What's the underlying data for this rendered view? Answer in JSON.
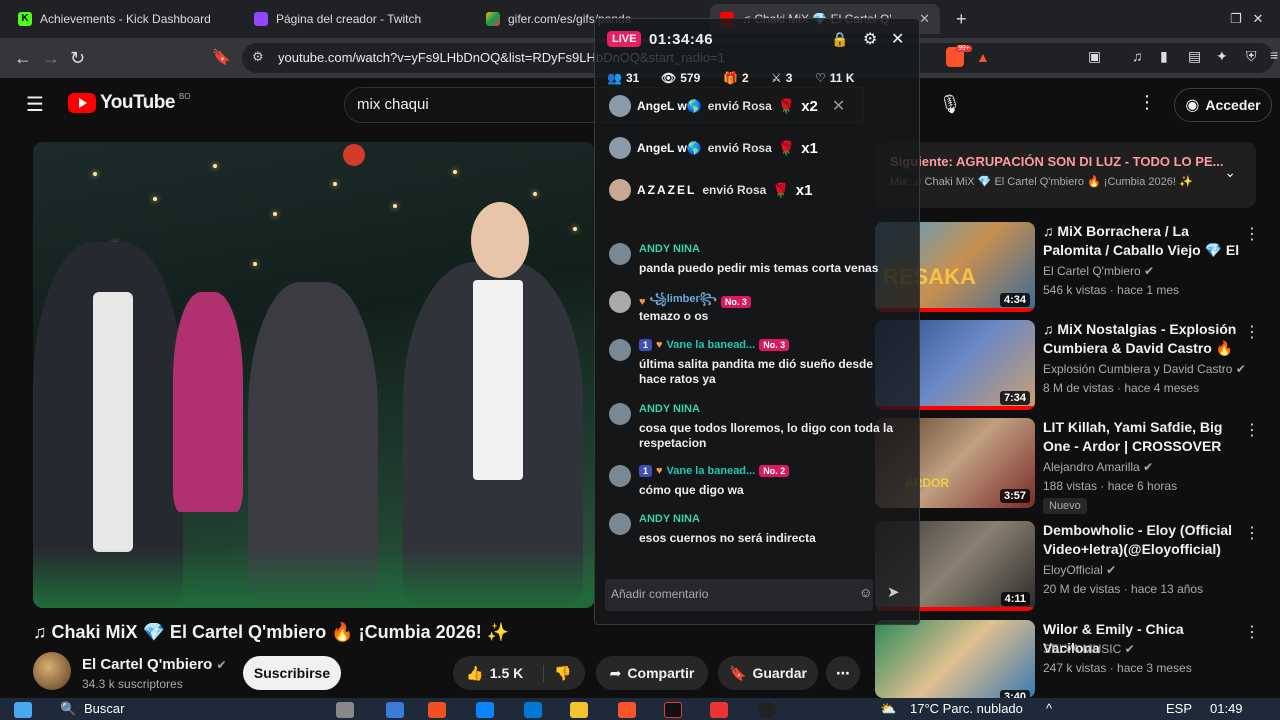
{
  "browser": {
    "tabs": [
      {
        "label": "Achievements - Kick Dashboard",
        "color": "#53fc18",
        "letter": "K"
      },
      {
        "label": "Página del creador - Twitch",
        "color": "#9146ff",
        "letter": ""
      },
      {
        "label": "gifer.com/es/gifs/panda",
        "color": "#f4b400",
        "letter": ""
      },
      {
        "label": "♫ Chaki MiX 💎 El Cartel Q'",
        "color": "#ff0000",
        "letter": ""
      }
    ],
    "new_tab": "+",
    "url": "youtube.com/watch?v=yFs9LHbDnOQ&list=RDyFs9LHbDnOQ&start_radio=1",
    "brave_count": "99+"
  },
  "youtube": {
    "logo_text": "YouTube",
    "logo_region": "BO",
    "search_value": "mix chaqui",
    "signin_label": "Acceder"
  },
  "video": {
    "title": "♫ Chaki MiX 💎 El Cartel Q'mbiero 🔥 ¡Cumbia 2026! ✨",
    "channel": "El Cartel Q'mbiero",
    "subscribers": "34.3 k suscriptores",
    "subscribe_label": "Suscribirse",
    "likes": "1.5 K",
    "share_label": "Compartir",
    "save_label": "Guardar"
  },
  "next": {
    "label": "Siguiente:",
    "title": "AGRUPACIÓN SON DI LUZ - TODO LO PE...",
    "playlist": "Mix: ♫ Chaki MiX 💎 El Cartel Q'mbiero 🔥 ¡Cumbia 2026! ✨"
  },
  "recommendations": [
    {
      "title": "♫ MiX Borrachera / La Palomita / Caballo Viejo 💎 El Cartel ...",
      "channel": "El Cartel Q'mbiero",
      "meta": "546 k vistas · hace 1 mes",
      "duration": "4:34",
      "badge": "",
      "watched": 1.0
    },
    {
      "title": "♫ MiX Nostalgias - Explosión Cumbiera & David Castro 🔥 ¡#...",
      "channel": "Explosión Cumbiera y David Castro",
      "meta": "8 M de vistas · hace 4 meses",
      "duration": "7:34",
      "badge": "",
      "watched": 1.0
    },
    {
      "title": "LIT Killah, Yami Safdie, Big One - Ardor | CROSSOVER #13 ...",
      "channel": "Alejandro Amarilla",
      "meta": "188 vistas · hace 6 horas",
      "duration": "3:57",
      "badge": "Nuevo",
      "watched": 0
    },
    {
      "title": "Dembowholic - Eloy (Official Video+letra)(@Eloyofficial)",
      "channel": "EloyOfficial",
      "meta": "20 M de vistas · hace 13 años",
      "duration": "4:11",
      "badge": "",
      "watched": 1.0
    },
    {
      "title": "Wilor & Emily - Chica Vacilona",
      "channel": "SELVA MUSIC",
      "meta": "247 k vistas · hace 3 meses",
      "duration": "3:40",
      "badge": "",
      "watched": 0
    }
  ],
  "kick": {
    "live": "LIVE",
    "timer": "01:34:46",
    "stats": {
      "followers": "31",
      "viewers": "579",
      "gifts": "2",
      "raids": "3",
      "likes": "11 K"
    },
    "gifts": [
      {
        "user": "AngeL w🌎",
        "text": "envió Rosa",
        "count": "x2"
      },
      {
        "user": "AngeL w🌎",
        "text": "envió Rosa",
        "count": "x1"
      },
      {
        "user": "AZAZEL",
        "text": "envió Rosa",
        "count": "x1"
      }
    ],
    "messages": [
      {
        "user": "ANDY NINA",
        "rank": "",
        "level": "",
        "text": "panda puedo pedir mis temas corta venas"
      },
      {
        "user": "꧁limber꧂",
        "rank": "No. 3",
        "level": "",
        "text": "temazo o os"
      },
      {
        "user": "Vane la banead...",
        "rank": "No. 3",
        "level": "1",
        "text": "última salita pandita me dió sueño desde hace ratos ya"
      },
      {
        "user": "ANDY NINA",
        "rank": "",
        "level": "",
        "text": "cosa que todos lloremos, lo digo con toda la respetacion"
      },
      {
        "user": "Vane la banead...",
        "rank": "No. 2",
        "level": "1",
        "text": "cómo que digo wa"
      },
      {
        "user": "ANDY NINA",
        "rank": "",
        "level": "",
        "text": "esos cuernos no será indirecta"
      }
    ],
    "comment_placeholder": "Añadir comentario"
  },
  "taskbar": {
    "search": "Buscar",
    "weather": "17°C  Parc. nublado",
    "lang": "ESP",
    "time": "01:49"
  }
}
